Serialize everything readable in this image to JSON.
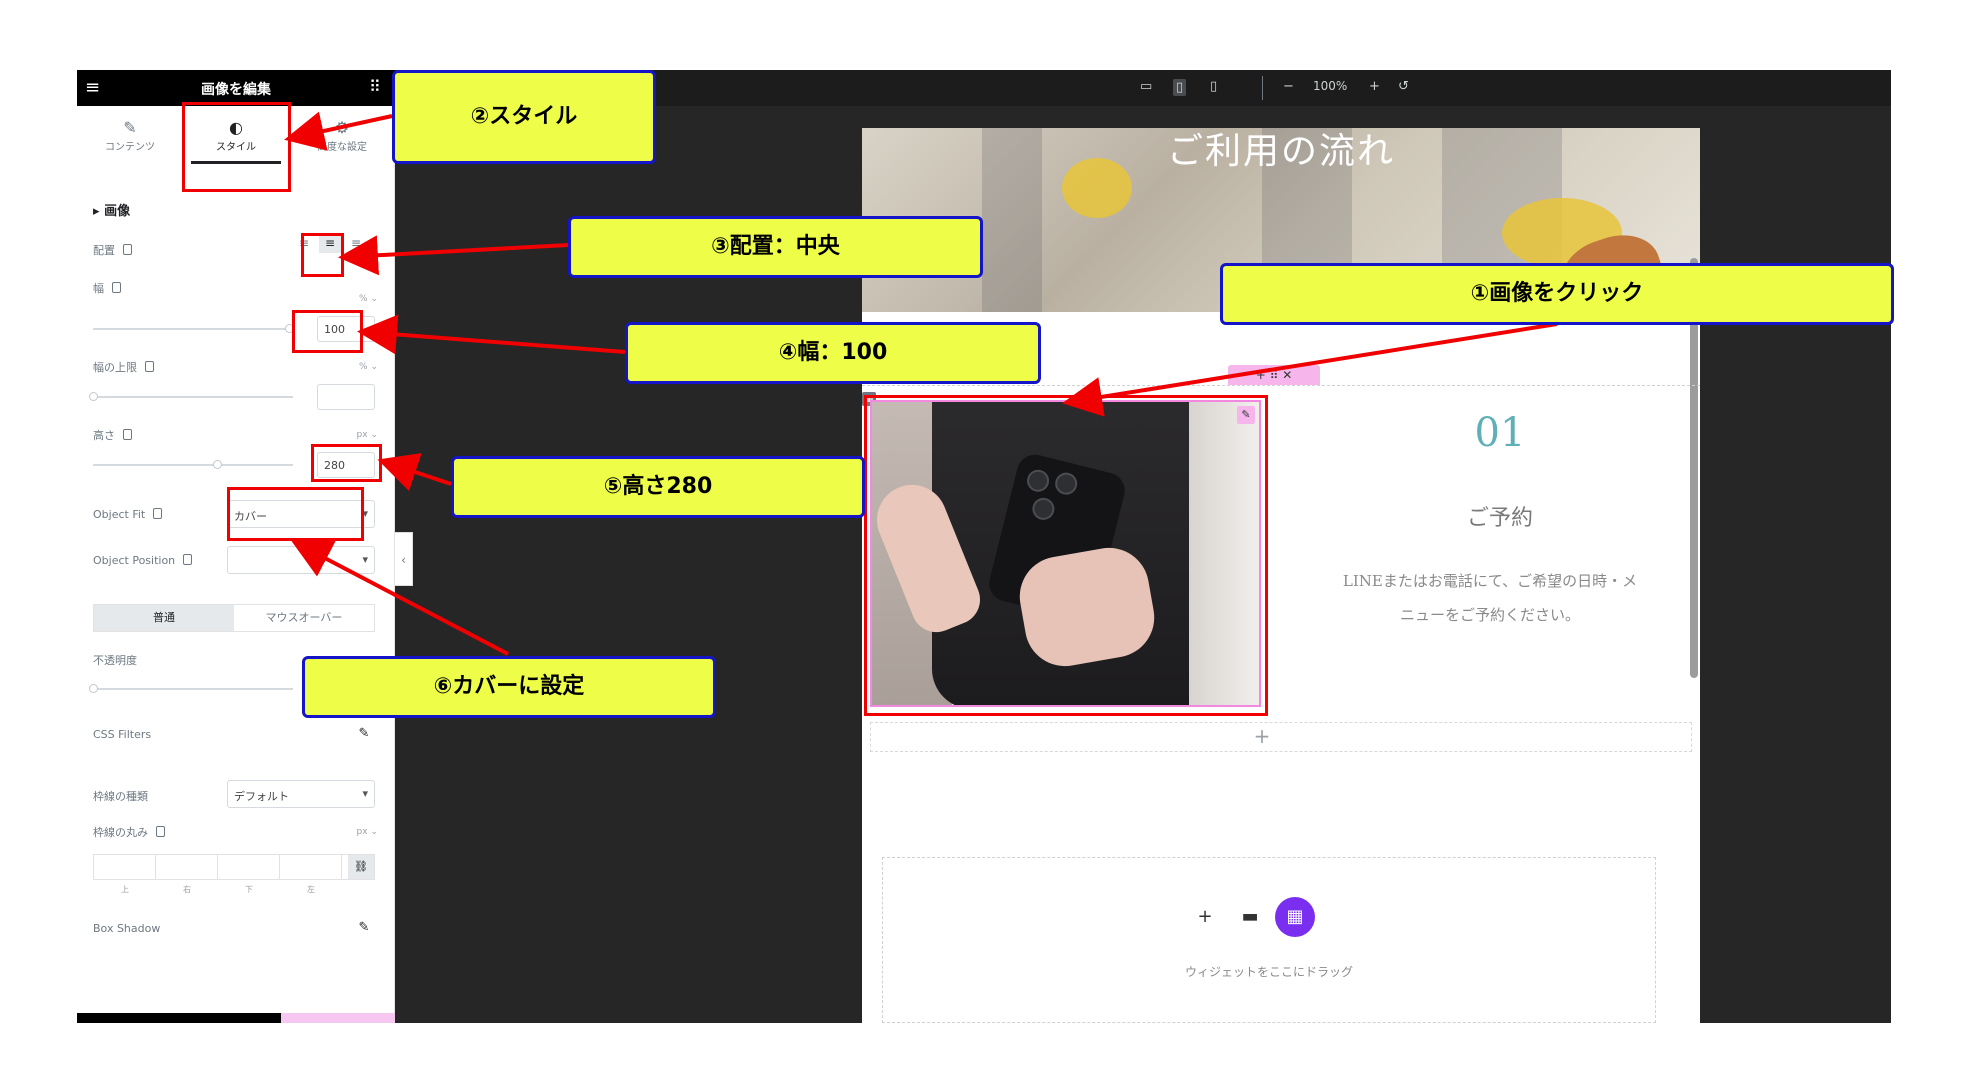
{
  "panel": {
    "title": "画像を編集",
    "menu_icon": "hamburger-icon",
    "grid_icon": "apps-grid-icon",
    "tabs": [
      {
        "label": "コンテンツ",
        "icon": "pencil-icon"
      },
      {
        "label": "スタイル",
        "icon": "half-circle-icon",
        "active": true
      },
      {
        "label": "高度な設定",
        "icon": "gear-icon"
      }
    ],
    "section_title": "画像",
    "alignment_label": "配置",
    "width_label": "幅",
    "width_unit": "% ⌄",
    "width_value": "100",
    "max_width_label": "幅の上限",
    "max_width_unit": "% ⌄",
    "height_label": "高さ",
    "height_unit": "px ⌄",
    "height_value": "280",
    "object_fit_label": "Object Fit",
    "object_fit_value": "カバー",
    "object_position_label": "Object Position",
    "state_tabs": [
      "普通",
      "マウスオーバー"
    ],
    "opacity_label": "不透明度",
    "css_filters_label": "CSS Filters",
    "border_type_label": "枠線の種類",
    "border_type_value": "デフォルト",
    "border_radius_label": "枠線の丸み",
    "border_radius_unit": "px ⌄",
    "radius_sides": [
      "上",
      "右",
      "下",
      "左"
    ],
    "box_shadow_label": "Box Shadow"
  },
  "topbar": {
    "zoom": "100%",
    "devices": [
      "desktop-icon",
      "tablet-icon",
      "mobile-icon"
    ],
    "active_device": "tablet-icon"
  },
  "page": {
    "hero_title": "ご利用の流れ",
    "step_number": "01",
    "step_title": "ご予約",
    "step_desc_line1": "LINEまたはお電話にて、ご希望の日時・メ",
    "step_desc_line2": "ニューをご予約ください。",
    "drop_text": "ウィジェットをここにドラッグ"
  },
  "callouts": {
    "c1": "①画像をクリック",
    "c2": "②スタイル",
    "c3": "③配置：中央",
    "c4": "④幅：100",
    "c5": "⑤高さ280",
    "c6": "⑥カバーに設定"
  },
  "colors": {
    "callout_fill": "#eefe48",
    "callout_border": "#1414c8",
    "highlight": "#f00000",
    "accent_teal": "#5fb0b6",
    "selection_pink": "#f288e0"
  }
}
